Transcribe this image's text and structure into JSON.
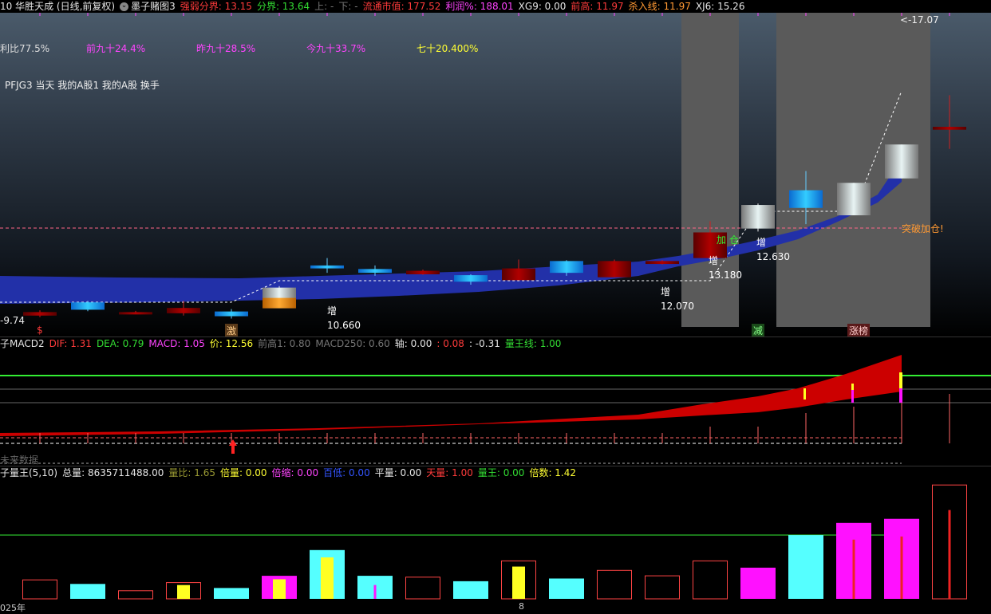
{
  "header": {
    "items": [
      {
        "text": "10 华胜天成 (日线,前复权)",
        "color": "#e6e6e6"
      },
      {
        "text": "墨子赌图3",
        "color": "#e6e6e6",
        "prefix_icon": "chevron-down-icon"
      },
      {
        "text": "强弱分界: 13.15",
        "color": "#ff3b3b"
      },
      {
        "text": "分界: 13.64",
        "color": "#33dd33"
      },
      {
        "text": "上: -",
        "color": "#777777"
      },
      {
        "text": "下: -",
        "color": "#777777"
      },
      {
        "text": "流通市值: 177.52",
        "color": "#ff3b3b"
      },
      {
        "text": "利润%: 188.01",
        "color": "#ff44ff"
      },
      {
        "text": "XG9: 0.00",
        "color": "#e6e6e6"
      },
      {
        "text": "前高: 11.97",
        "color": "#ff3b3b"
      },
      {
        "text": "杀入线: 11.97",
        "color": "#ff9933"
      },
      {
        "text": "XJ6: 15.26",
        "color": "#e6e6e6"
      }
    ]
  },
  "main": {
    "stats": [
      {
        "text": "利比77.5%",
        "color": "#dddddd"
      },
      {
        "text": "前九十24.4%",
        "color": "#ff44ff"
      },
      {
        "text": "昨九十28.5%",
        "color": "#ff44ff"
      },
      {
        "text": "今九十33.7%",
        "color": "#ff44ff"
      },
      {
        "text": "七十20.400%",
        "color": "#ffff33"
      }
    ],
    "indicators_line": "PFJG3 当天 我的A股1 我的A股 换手",
    "breakout_label": "突破加仓!",
    "jiacang_label": "加 仓",
    "left_value": "-9.74",
    "top_price": "17.07",
    "markers": {
      "dollar": "$",
      "ji": "激",
      "jian": "减",
      "zhangting": "涨榜"
    },
    "annotations": [
      {
        "tag": "增",
        "value": "10.660"
      },
      {
        "tag": "增",
        "value": "12.070"
      },
      {
        "tag": "增",
        "value": "13.180"
      },
      {
        "tag": "增",
        "value": "12.630"
      }
    ]
  },
  "macd": {
    "items": [
      {
        "text": "子MACD2",
        "color": "#e6e6e6"
      },
      {
        "text": "DIF: 1.31",
        "color": "#ff3b3b"
      },
      {
        "text": "DEA: 0.79",
        "color": "#33dd33"
      },
      {
        "text": "MACD: 1.05",
        "color": "#ff44ff"
      },
      {
        "text": "价: 12.56",
        "color": "#ffff33"
      },
      {
        "text": "前高1: 0.80",
        "color": "#777777"
      },
      {
        "text": "MACD250: 0.60",
        "color": "#777777"
      },
      {
        "text": "轴: 0.00",
        "color": "#e6e6e6"
      },
      {
        "text": ": 0.08",
        "color": "#ff3b3b"
      },
      {
        "text": ": -0.31",
        "color": "#e6e6e6"
      },
      {
        "text": "量王线: 1.00",
        "color": "#33dd33"
      }
    ],
    "future_data_label": "未来数据"
  },
  "volume": {
    "items": [
      {
        "text": "子量王(5,10)",
        "color": "#e6e6e6"
      },
      {
        "text": "总量: 8635711488.00",
        "color": "#e6e6e6"
      },
      {
        "text": "量比: 1.65",
        "color": "#999933"
      },
      {
        "text": "倍量: 0.00",
        "color": "#ffff33"
      },
      {
        "text": "倍缩: 0.00",
        "color": "#ff44ff"
      },
      {
        "text": "百低: 0.00",
        "color": "#3355ff"
      },
      {
        "text": "平量: 0.00",
        "color": "#e6e6e6"
      },
      {
        "text": "天量: 1.00",
        "color": "#ff3b3b"
      },
      {
        "text": "量王: 0.00",
        "color": "#33dd33"
      },
      {
        "text": "倍数: 1.42",
        "color": "#ffff33"
      }
    ]
  },
  "xaxis": {
    "left_label": "025年",
    "mid_label": "8"
  },
  "candles": [
    {
      "o": 9.6,
      "c": 9.72,
      "h": 9.78,
      "l": 9.55,
      "color": "red"
    },
    {
      "o": 9.8,
      "c": 10.05,
      "h": 10.1,
      "l": 9.75,
      "color": "blue"
    },
    {
      "o": 9.68,
      "c": 9.72,
      "h": 9.76,
      "l": 9.65,
      "color": "red"
    },
    {
      "o": 9.68,
      "c": 9.86,
      "h": 10.1,
      "l": 9.6,
      "color": "red"
    },
    {
      "o": 9.58,
      "c": 9.74,
      "h": 9.82,
      "l": 9.5,
      "color": "blue"
    },
    {
      "o": 9.85,
      "c": 10.55,
      "h": 10.6,
      "l": 9.85,
      "color": "white-orange"
    },
    {
      "o": 11.2,
      "c": 11.3,
      "h": 11.55,
      "l": 11.05,
      "color": "blue"
    },
    {
      "o": 11.05,
      "c": 11.18,
      "h": 11.3,
      "l": 10.95,
      "color": "blue"
    },
    {
      "o": 11.0,
      "c": 11.12,
      "h": 11.16,
      "l": 10.98,
      "color": "red"
    },
    {
      "o": 10.75,
      "c": 10.97,
      "h": 11.0,
      "l": 10.65,
      "color": "blue"
    },
    {
      "o": 10.8,
      "c": 11.2,
      "h": 11.5,
      "l": 10.8,
      "color": "red"
    },
    {
      "o": 11.05,
      "c": 11.45,
      "h": 11.48,
      "l": 10.95,
      "color": "blue"
    },
    {
      "o": 10.9,
      "c": 11.45,
      "h": 11.5,
      "l": 10.9,
      "color": "red"
    },
    {
      "o": 11.35,
      "c": 11.45,
      "h": 11.48,
      "l": 11.33,
      "color": "red"
    },
    {
      "o": 11.55,
      "c": 12.42,
      "h": 12.8,
      "l": 11.5,
      "color": "red"
    },
    {
      "o": 12.55,
      "c": 13.35,
      "h": 13.4,
      "l": 12.45,
      "color": "white"
    },
    {
      "o": 13.25,
      "c": 13.85,
      "h": 14.5,
      "l": 12.7,
      "color": "blue"
    },
    {
      "o": 13.0,
      "c": 14.1,
      "h": 14.1,
      "l": 13.0,
      "color": "white"
    },
    {
      "o": 14.25,
      "c": 15.4,
      "h": 15.4,
      "l": 14.25,
      "color": "white"
    },
    {
      "o": 15.9,
      "c": 16.0,
      "h": 17.07,
      "l": 15.25,
      "color": "red"
    }
  ],
  "volumes": [
    {
      "v": 0.7,
      "kind": "red-hollow"
    },
    {
      "v": 0.55,
      "kind": "cyan"
    },
    {
      "v": 0.3,
      "kind": "red-hollow"
    },
    {
      "v": 0.6,
      "kind": "red-hollow-yellow"
    },
    {
      "v": 0.4,
      "kind": "cyan"
    },
    {
      "v": 0.85,
      "kind": "magenta-yellow"
    },
    {
      "v": 1.8,
      "kind": "cyan-yellow"
    },
    {
      "v": 0.85,
      "kind": "cyan-magenta"
    },
    {
      "v": 0.8,
      "kind": "red-hollow"
    },
    {
      "v": 0.65,
      "kind": "cyan"
    },
    {
      "v": 1.4,
      "kind": "red-hollow-yellow"
    },
    {
      "v": 0.75,
      "kind": "cyan"
    },
    {
      "v": 1.05,
      "kind": "red-hollow"
    },
    {
      "v": 0.85,
      "kind": "red-hollow"
    },
    {
      "v": 1.4,
      "kind": "red-hollow"
    },
    {
      "v": 1.15,
      "kind": "magenta"
    },
    {
      "v": 2.35,
      "kind": "cyan"
    },
    {
      "v": 2.8,
      "kind": "magenta-red"
    },
    {
      "v": 2.95,
      "kind": "magenta-red"
    },
    {
      "v": 4.2,
      "kind": "red-hollow-red"
    }
  ],
  "colors": {
    "red_candle": "#8b0000",
    "blue_candle": "#1e90ff",
    "band": "#2230a8",
    "macd_fill": "#cc0000",
    "cyan_vol": "#55ffff",
    "magenta_vol": "#ff11ff",
    "yellow": "#ffff22",
    "green_line": "#33ee33",
    "gray_highlight": "#5a5a5a"
  }
}
